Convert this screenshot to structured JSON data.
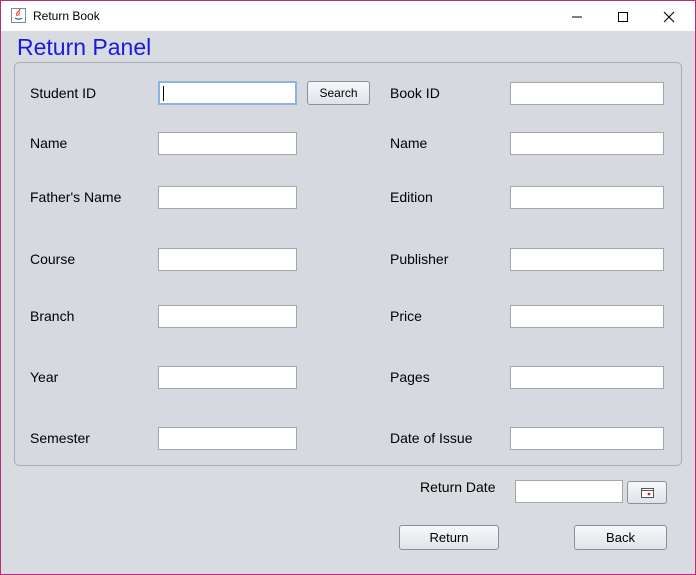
{
  "window": {
    "title": "Return Book",
    "minimize_icon": "minimize-icon",
    "maximize_icon": "maximize-icon",
    "close_icon": "close-icon",
    "border_color": "#c0287a"
  },
  "panel": {
    "title": "Return Panel",
    "title_color": "#1a1ae0"
  },
  "student": {
    "student_id_label": "Student ID",
    "student_id_value": "",
    "search_label": "Search",
    "name_label": "Name",
    "fathers_name_label": "Father's Name",
    "course_label": "Course",
    "branch_label": "Branch",
    "year_label": "Year",
    "semester_label": "Semester"
  },
  "book": {
    "book_id_label": "Book ID",
    "name_label": "Name",
    "edition_label": "Edition",
    "publisher_label": "Publisher",
    "price_label": "Price",
    "pages_label": "Pages",
    "date_of_issue_label": "Date of Issue"
  },
  "footer": {
    "return_date_label": "Return Date",
    "calendar_icon": "calendar-icon",
    "return_label": "Return",
    "back_label": "Back"
  }
}
